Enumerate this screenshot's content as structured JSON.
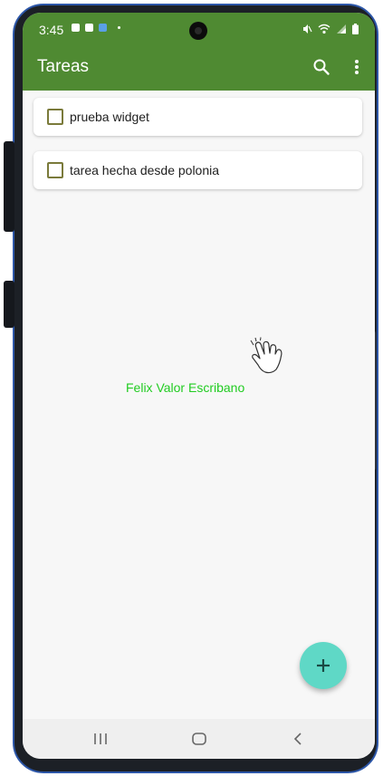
{
  "status_bar": {
    "time": "3:45",
    "left_icons": [
      "briefcase-icon",
      "image-icon",
      "cast-icon",
      "dot-icon"
    ],
    "right_icons": [
      "mute-icon",
      "wifi-icon",
      "signal-icon",
      "battery-icon"
    ]
  },
  "app_bar": {
    "title": "Tareas",
    "actions": [
      "search-icon",
      "more-vert-icon"
    ]
  },
  "tasks": [
    {
      "label": "prueba widget",
      "checked": false
    },
    {
      "label": "tarea hecha desde polonia",
      "checked": false
    }
  ],
  "watermark": "Felix Valor Escribano",
  "fab": {
    "icon": "plus-icon"
  },
  "nav_bar": [
    "recent-apps-icon",
    "home-icon",
    "back-icon"
  ],
  "colors": {
    "app_bar": "#4f8a32",
    "fab": "#5fd8c6",
    "checkbox_border": "#7a7a3a",
    "watermark_text": "#22cc22",
    "screen_bg": "#f7f7f7"
  }
}
